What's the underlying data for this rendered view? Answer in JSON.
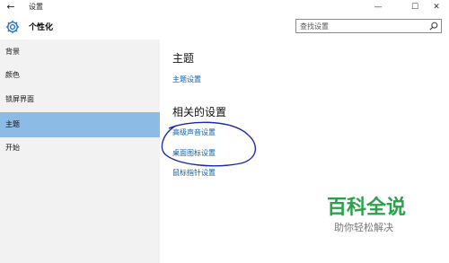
{
  "window": {
    "back_glyph": "←",
    "title": "设置",
    "minimize_glyph": "—",
    "maximize_glyph": "☐",
    "close_glyph": "✕"
  },
  "header": {
    "icon": "gear-icon",
    "title": "个性化",
    "search": {
      "placeholder": "查找设置",
      "icon": "search-icon"
    }
  },
  "sidebar": {
    "items": [
      {
        "label": "背景",
        "active": false
      },
      {
        "label": "颜色",
        "active": false
      },
      {
        "label": "锁屏界面",
        "active": false
      },
      {
        "label": "主题",
        "active": true
      },
      {
        "label": "开始",
        "active": false
      }
    ]
  },
  "main": {
    "theme_heading": "主题",
    "theme_link": "主题设置",
    "related_heading": "相关的设置",
    "related_links": [
      "高级声音设置",
      "桌面图标设置",
      "鼠标指针设置"
    ]
  },
  "watermark": {
    "logo": "百科全说",
    "tagline": "助你轻松解决"
  },
  "colors": {
    "accent_selected": "#8cbbe5",
    "link": "#0d5ea8",
    "annotation": "#1b2aa8",
    "watermark_green": "#2aa14a"
  }
}
